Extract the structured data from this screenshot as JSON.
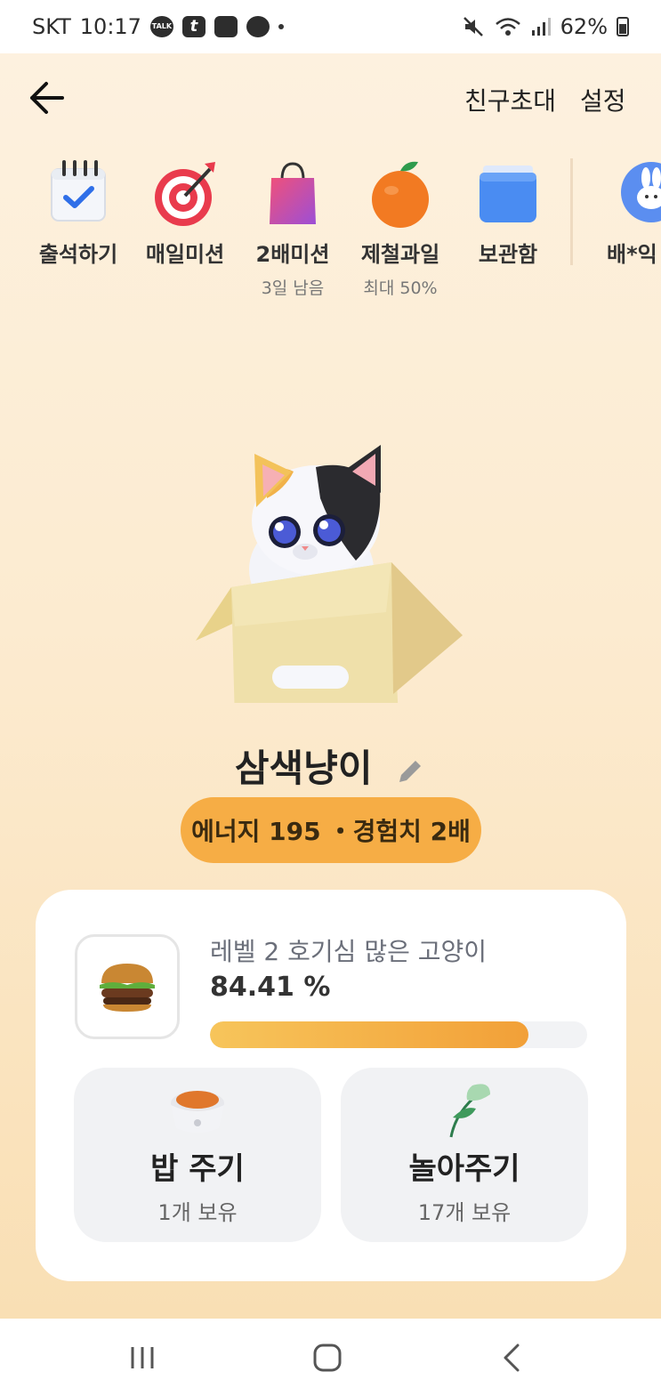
{
  "status_bar": {
    "carrier": "SKT",
    "time": "10:17",
    "talk_icon_label": "TALK",
    "t_icon_label": "t",
    "battery": "62%"
  },
  "header": {
    "invite_label": "친구초대",
    "settings_label": "설정"
  },
  "shortcuts": [
    {
      "label": "출석하기",
      "sub": "",
      "icon": "calendar-check-icon"
    },
    {
      "label": "매일미션",
      "sub": "",
      "icon": "target-icon"
    },
    {
      "label": "2배미션",
      "sub": "3일 남음",
      "icon": "shopping-bag-icon"
    },
    {
      "label": "제철과일",
      "sub": "최대 50%",
      "icon": "tangerine-icon"
    },
    {
      "label": "보관함",
      "sub": "",
      "icon": "folder-box-icon"
    },
    {
      "label": "배*익",
      "sub": "",
      "icon": "rabbit-avatar-icon"
    }
  ],
  "pet": {
    "name": "삼색냥이",
    "energy": "에너지 195",
    "bonus": "・경험치 2배"
  },
  "level_card": {
    "level_title": "레벨 2 호기심 많은 고양이",
    "percent": "84.41 %",
    "progress": 0.8441
  },
  "actions": {
    "feed": {
      "title": "밥 주기",
      "count": "1개 보유"
    },
    "play": {
      "title": "놀아주기",
      "count": "17개 보유"
    }
  },
  "colors": {
    "accent": "#f6ad45",
    "background_top": "#fdf1df",
    "background_bottom": "#f9dfb4"
  }
}
